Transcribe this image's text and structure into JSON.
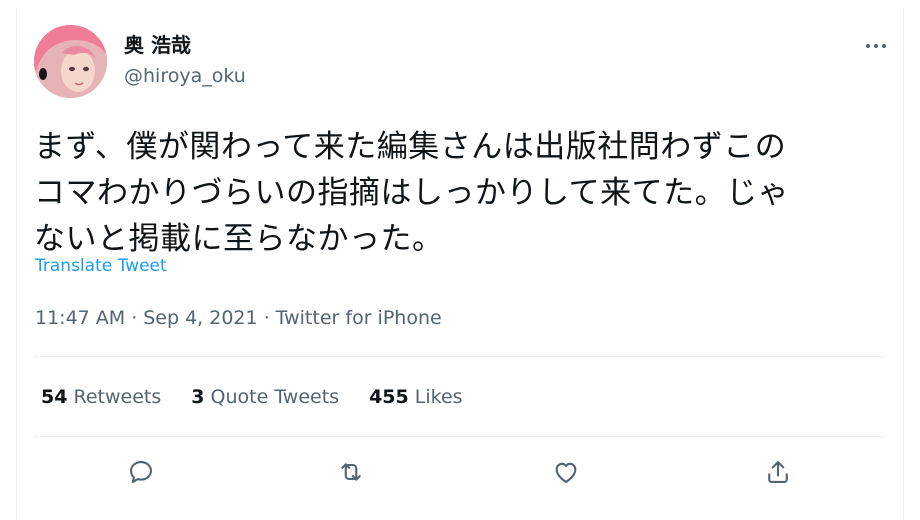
{
  "user": {
    "display_name": "奥 浩哉",
    "handle": "@hiroya_oku"
  },
  "tweet": {
    "text_lines": [
      "まず、僕が関わって来た編集さんは出版社問わずこの",
      "コマわかりづらいの指摘はしっかりして来てた。じゃ",
      "ないと掲載に至らなかった。"
    ],
    "translate_label": "Translate Tweet",
    "time": "11:47 AM",
    "date": "Sep 4, 2021",
    "source": "Twitter for iPhone",
    "separator": "·"
  },
  "stats": {
    "retweets": {
      "count": "54",
      "label": "Retweets"
    },
    "quote_tweets": {
      "count": "3",
      "label": "Quote Tweets"
    },
    "likes": {
      "count": "455",
      "label": "Likes"
    }
  },
  "icons": {
    "more": "more-options-icon",
    "reply": "reply-icon",
    "retweet": "retweet-icon",
    "like": "heart-icon",
    "share": "share-icon"
  },
  "colors": {
    "text": "#0f1419",
    "secondary": "#536471",
    "link": "#1d9bf0",
    "divider": "#eff3f4"
  }
}
